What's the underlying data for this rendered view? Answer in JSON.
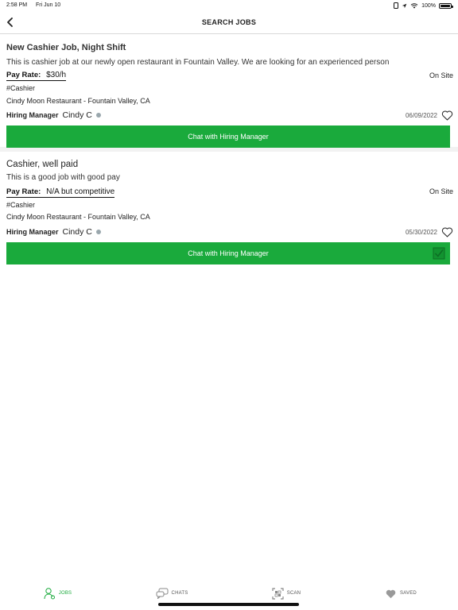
{
  "status_bar": {
    "time": "2:58 PM",
    "date": "Fri Jun 10",
    "battery": "100%",
    "battery_level": 1.0
  },
  "nav": {
    "title": "SEARCH JOBS",
    "back_icon": "chevron-left-icon"
  },
  "jobs": [
    {
      "title": "New Cashier Job, Night Shift",
      "description": "This is cashier job at our newly open restaurant in Fountain Valley. We are looking for an experienced person",
      "pay_label": "Pay Rate:",
      "pay_value": "$30/h",
      "location_type": "On Site",
      "tag": "#Cashier",
      "company": "Cindy Moon Restaurant - Fountain Valley, CA",
      "manager_label": "Hiring Manager",
      "manager_name": "Cindy C",
      "date": "06/09/2022",
      "chat_label": "Chat with Hiring Manager"
    },
    {
      "title": "Cashier, well paid",
      "description": "This is a good job with good pay",
      "pay_label": "Pay Rate:",
      "pay_value": "N/A but competitive",
      "location_type": "On Site",
      "tag": "#Cashier",
      "company": "Cindy Moon Restaurant - Fountain Valley, CA",
      "manager_label": "Hiring Manager",
      "manager_name": "Cindy C",
      "date": "05/30/2022",
      "chat_label": "Chat with Hiring Manager"
    }
  ],
  "tabs": [
    {
      "label": "JOBS",
      "icon": "jobs-icon",
      "active": true
    },
    {
      "label": "CHATS",
      "icon": "chats-icon",
      "active": false
    },
    {
      "label": "SCAN",
      "icon": "scan-icon",
      "active": false
    },
    {
      "label": "SAVED",
      "icon": "heart-icon",
      "active": false
    }
  ],
  "colors": {
    "accent": "#1aaa3c",
    "status_dot": "#9aa7ad"
  }
}
